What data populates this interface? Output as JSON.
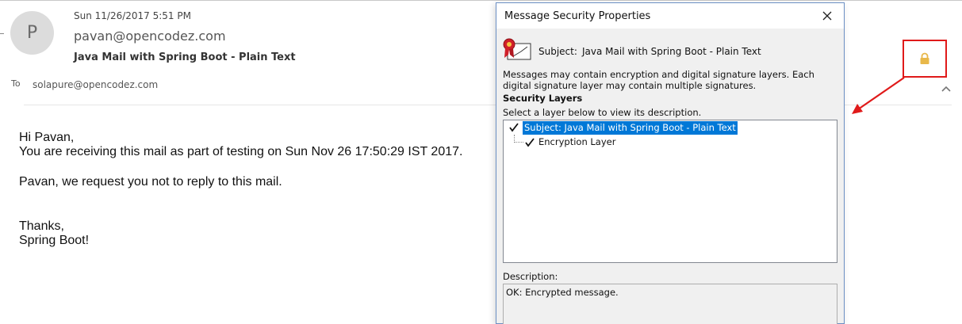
{
  "email": {
    "avatar_initial": "P",
    "date": "Sun 11/26/2017 5:51 PM",
    "from": "pavan@opencodez.com",
    "subject": "Java Mail with Spring Boot - Plain Text",
    "to_label": "To",
    "to": "solapure@opencodez.com",
    "body": {
      "line1": "Hi Pavan,",
      "line2": "You are receiving this mail as part of testing on Sun Nov 26 17:50:29 IST 2017.",
      "line3": "Pavan, we request you not to reply to this mail.",
      "line4": "Thanks,",
      "line5": "Spring Boot!"
    }
  },
  "dialog": {
    "title": "Message Security Properties",
    "subject_label": "Subject:",
    "subject_value": "Java Mail with Spring Boot - Plain Text",
    "message": "Messages may contain encryption and digital signature layers. Each digital signature layer may contain multiple signatures.",
    "security_layers_heading": "Security Layers",
    "instruction": "Select a layer below to view its description.",
    "layers": [
      {
        "label": "Subject: Java Mail with Spring Boot - Plain Text",
        "selected": true
      },
      {
        "label": "Encryption Layer",
        "selected": false
      }
    ],
    "description_label": "Description:",
    "description_text": "OK: Encrypted message."
  },
  "icons": {
    "lock": "lock-icon",
    "close": "close-icon",
    "certificate": "certificate-icon",
    "check": "check-icon",
    "chevron_up": "chevron-up-icon"
  },
  "colors": {
    "selection": "#0078d7",
    "annotation_red": "#e01a1a",
    "lock_gold": "#e8b84a",
    "dialog_border": "#6b8fc4"
  }
}
